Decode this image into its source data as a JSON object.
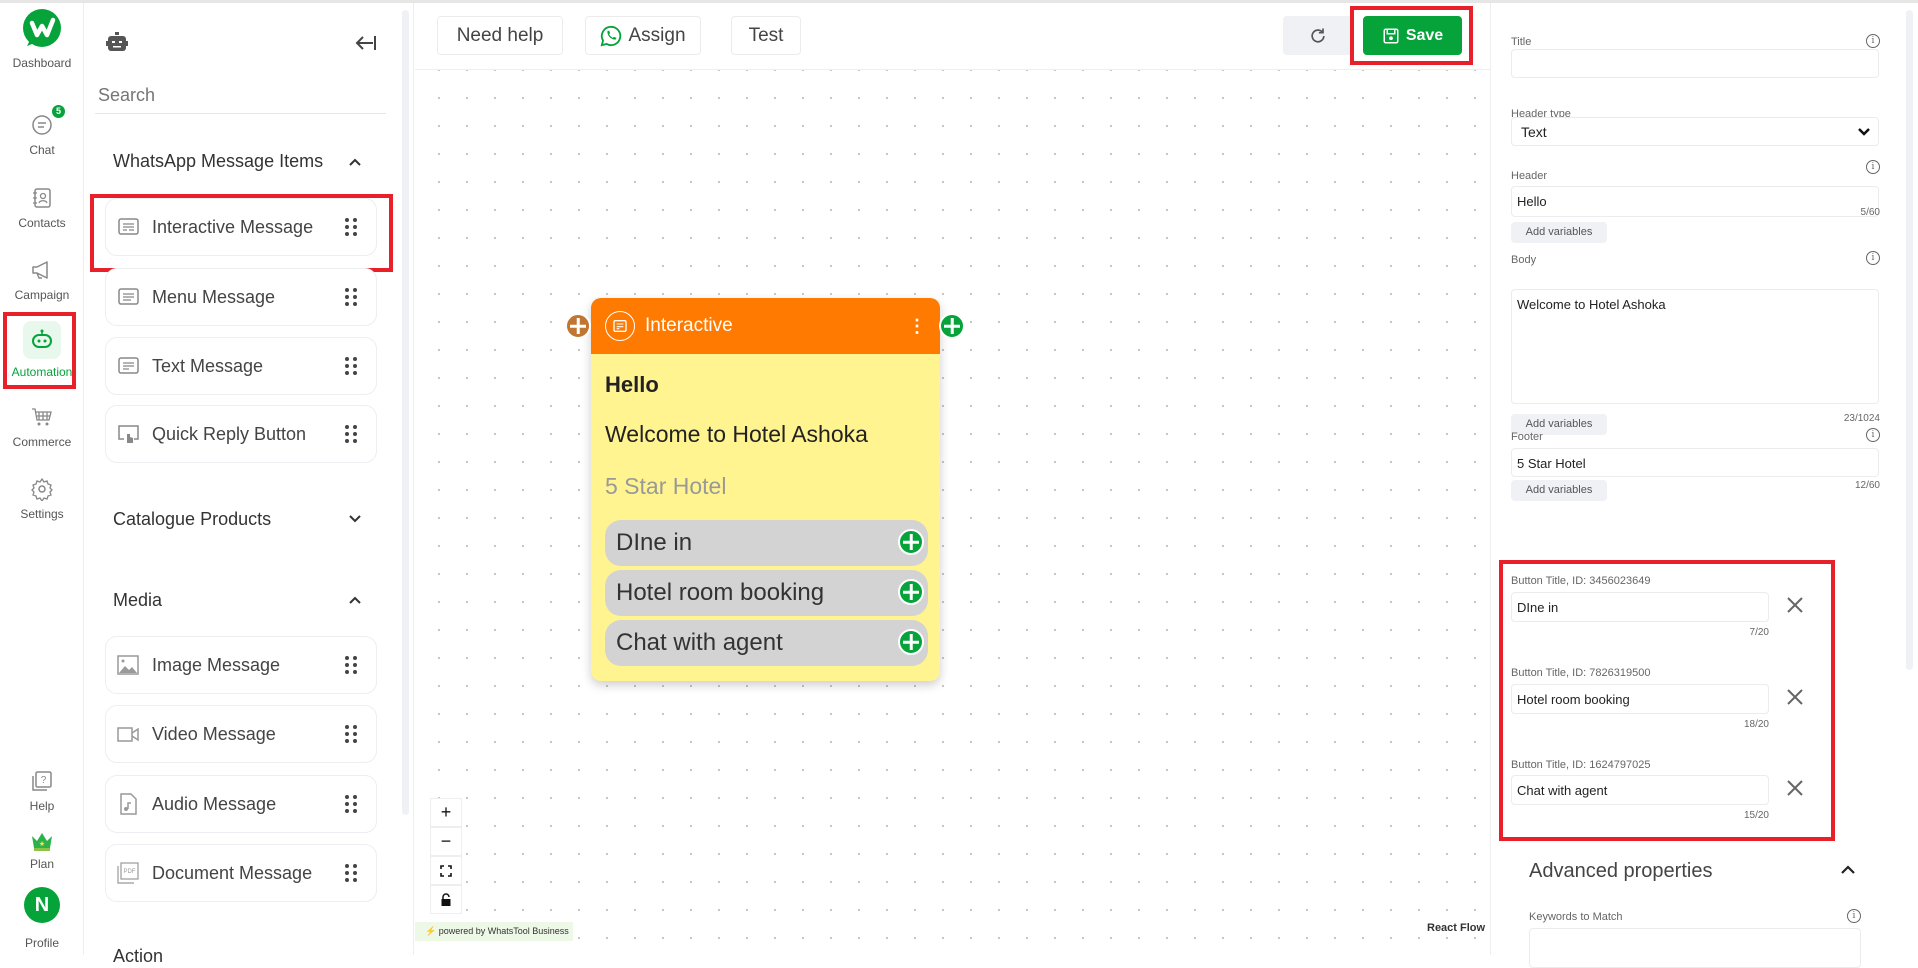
{
  "nav": {
    "items": [
      {
        "label": "Dashboard",
        "icon": "whatstool-logo"
      },
      {
        "label": "Chat",
        "icon": "chat-icon",
        "badge": "5"
      },
      {
        "label": "Contacts",
        "icon": "contacts-icon"
      },
      {
        "label": "Campaign",
        "icon": "megaphone-icon"
      },
      {
        "label": "Automation",
        "icon": "robot-icon",
        "active": true
      },
      {
        "label": "Commerce",
        "icon": "cart-icon"
      },
      {
        "label": "Settings",
        "icon": "gear-icon"
      },
      {
        "label": "Help",
        "icon": "help-icon"
      },
      {
        "label": "Plan",
        "icon": "crown-icon"
      },
      {
        "label": "Profile",
        "icon": "avatar",
        "initial": "N"
      }
    ]
  },
  "panel": {
    "search_placeholder": "Search",
    "sections": [
      {
        "title": "WhatsApp Message Items",
        "expanded": true,
        "items": [
          "Interactive Message",
          "Menu Message",
          "Text Message",
          "Quick Reply Button"
        ]
      },
      {
        "title": "Catalogue Products",
        "expanded": false
      },
      {
        "title": "Media",
        "expanded": true,
        "items": [
          "Image Message",
          "Video Message",
          "Audio Message",
          "Document Message"
        ]
      },
      {
        "title": "Action",
        "expanded": false
      }
    ]
  },
  "toolbar": {
    "need_help": "Need help",
    "assign": "Assign",
    "test": "Test",
    "save": "Save"
  },
  "node": {
    "type": "Interactive",
    "header": "Hello",
    "body": "Welcome to Hotel Ashoka",
    "footer": "5 Star Hotel",
    "buttons": [
      "DIne in",
      "Hotel room booking",
      "Chat with agent"
    ]
  },
  "canvas": {
    "powered_by": "powered by WhatsTool Business",
    "attribution": "React Flow",
    "controls": [
      "zoom-in",
      "zoom-out",
      "fit-view",
      "lock"
    ]
  },
  "form": {
    "title_label": "Title",
    "title_value": "",
    "header_type_label": "Header type",
    "header_type_value": "Text",
    "header_label": "Header",
    "header_value": "Hello",
    "header_count": "5/60",
    "body_label": "Body",
    "body_value": "Welcome to Hotel Ashoka",
    "body_count": "23/1024",
    "footer_label": "Footer",
    "footer_value": "5 Star Hotel",
    "footer_count": "12/60",
    "add_variables": "Add variables",
    "buttons": [
      {
        "label": "Button Title, ID: 3456023649",
        "value": "DIne in",
        "count": "7/20"
      },
      {
        "label": "Button Title, ID: 7826319500",
        "value": "Hotel room booking",
        "count": "18/20"
      },
      {
        "label": "Button Title, ID: 1624797025",
        "value": "Chat with agent",
        "count": "15/20"
      }
    ],
    "advanced_label": "Advanced properties",
    "keywords_label": "Keywords to Match"
  },
  "colors": {
    "brand": "#06a33a",
    "node_header": "#ff7a00",
    "node_body": "#fff48f",
    "highlight": "#e8202a"
  }
}
